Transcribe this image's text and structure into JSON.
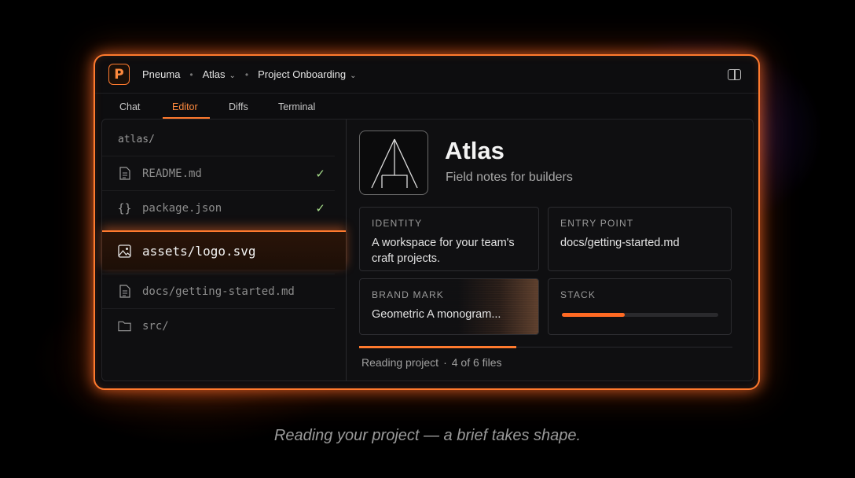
{
  "app": {
    "logo_letter": "P",
    "breadcrumb": [
      "Pneuma",
      "Atlas",
      "Project Onboarding"
    ]
  },
  "tabs": [
    "Chat",
    "Editor",
    "Diffs",
    "Terminal"
  ],
  "active_tab": "Editor",
  "sidebar": {
    "root": "atlas/",
    "files": [
      {
        "name": "README.md",
        "icon": "file-icon",
        "checked": true
      },
      {
        "name": "package.json",
        "icon": "braces-icon",
        "checked": true
      },
      {
        "name": "assets/logo.svg",
        "icon": "image-icon",
        "active": true
      },
      {
        "name": "docs/getting-started.md",
        "icon": "file-icon"
      },
      {
        "name": "src/",
        "icon": "folder-icon"
      }
    ]
  },
  "project": {
    "title": "Atlas",
    "subtitle": "Field notes for builders"
  },
  "cards": {
    "identity": {
      "label": "IDENTITY",
      "value": "A workspace for your team's craft projects."
    },
    "entry_point": {
      "label": "ENTRY POINT",
      "value": "docs/getting-started.md"
    },
    "brand_mark": {
      "label": "BRAND MARK",
      "value": "Geometric A monogram..."
    },
    "stack": {
      "label": "STACK",
      "progress": 0.4
    }
  },
  "status": {
    "text": "Reading project",
    "count": "4 of 6 files",
    "progress": 0.42
  },
  "caption": "Reading your project — a brief takes shape.",
  "colors": {
    "accent": "#ff7a2e",
    "check": "#a6dd8b",
    "background": "#000000"
  }
}
